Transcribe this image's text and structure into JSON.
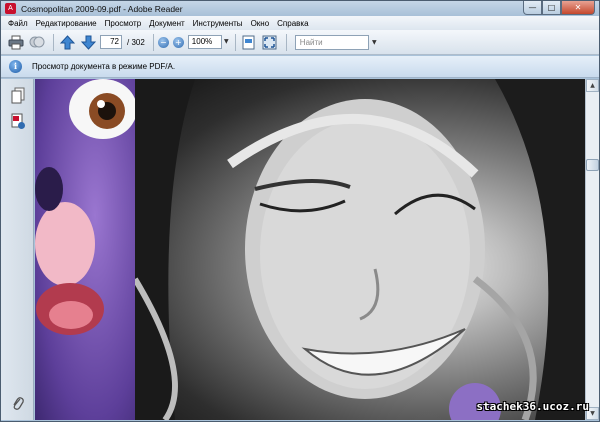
{
  "window": {
    "title": "Cosmopolitan 2009-09.pdf - Adobe Reader",
    "controls": {
      "minimize": "—",
      "maximize": "□",
      "close": "✕"
    }
  },
  "menubar": {
    "items": [
      "Файл",
      "Редактирование",
      "Просмотр",
      "Документ",
      "Инструменты",
      "Окно",
      "Справка"
    ]
  },
  "toolbar": {
    "current_page": "72",
    "page_total": "/ 302",
    "zoom": "100%",
    "find_placeholder": "Найти"
  },
  "infobar": {
    "message": "Просмотр документа в режиме PDF/A."
  },
  "watermark": "stachek36.ucoz.ru",
  "colors": {
    "titlebar": "#a8c0d8",
    "close_button": "#c4472d",
    "infobar": "#c9dbed"
  }
}
